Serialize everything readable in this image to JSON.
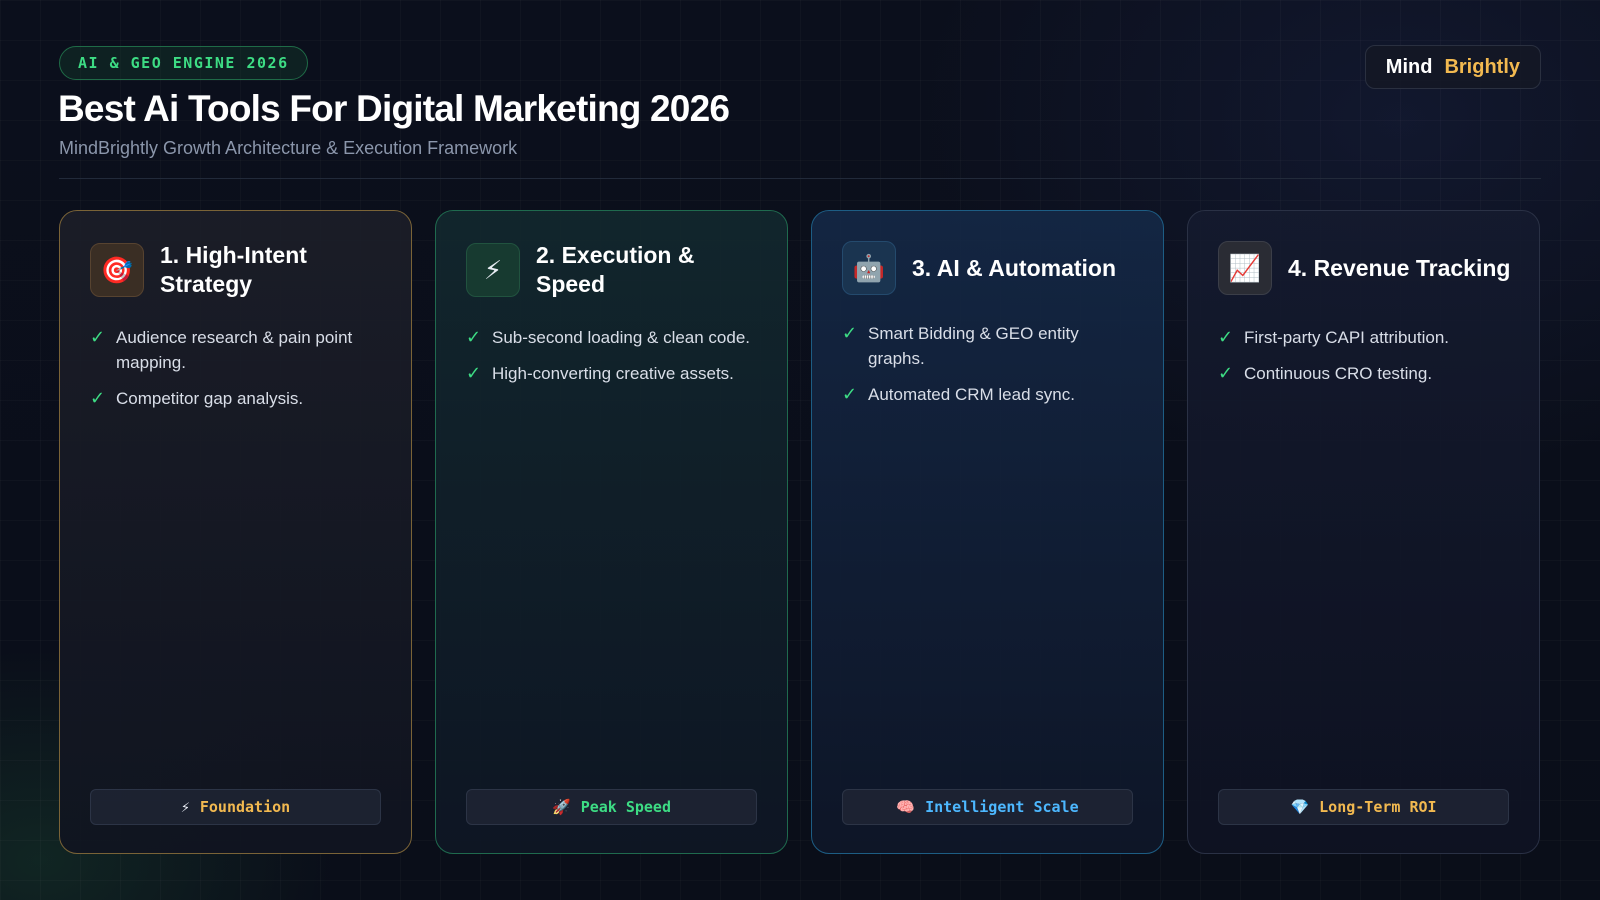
{
  "header": {
    "badge": "AI & GEO ENGINE 2026",
    "title": "Best Ai Tools For Digital Marketing 2026",
    "subtitle": "MindBrightly Growth Architecture & Execution Framework",
    "logo_part1": "Mind",
    "logo_part2": "Brightly"
  },
  "colors": {
    "accent_green": "#3ddc84",
    "accent_gold": "#f2b950",
    "accent_blue": "#4db8ff",
    "background": "#0a0e1a"
  },
  "cards": [
    {
      "title": "1. High-Intent Strategy",
      "icon": "target-icon",
      "icon_glyph": "🎯",
      "items": [
        "Audience research & pain point mapping.",
        "Competitor gap analysis."
      ],
      "footer_icon": "⚡",
      "footer_icon_name": "lightning-icon",
      "footer": "Foundation"
    },
    {
      "title": "2. Execution & Speed",
      "icon": "lightning-icon",
      "icon_glyph": "⚡",
      "items": [
        "Sub-second loading & clean code.",
        "High-converting creative assets."
      ],
      "footer_icon": "🚀",
      "footer_icon_name": "rocket-icon",
      "footer": "Peak Speed"
    },
    {
      "title": "3. AI & Automation",
      "icon": "robot-icon",
      "icon_glyph": "🤖",
      "items": [
        "Smart Bidding & GEO entity graphs.",
        "Automated CRM lead sync."
      ],
      "footer_icon": "🧠",
      "footer_icon_name": "brain-icon",
      "footer": "Intelligent Scale"
    },
    {
      "title": "4. Revenue Tracking",
      "icon": "chart-increasing-icon",
      "icon_glyph": "📈",
      "items": [
        "First-party CAPI attribution.",
        "Continuous CRO testing."
      ],
      "footer_icon": "💎",
      "footer_icon_name": "gem-icon",
      "footer": "Long-Term ROI"
    }
  ],
  "check_glyph": "✓"
}
